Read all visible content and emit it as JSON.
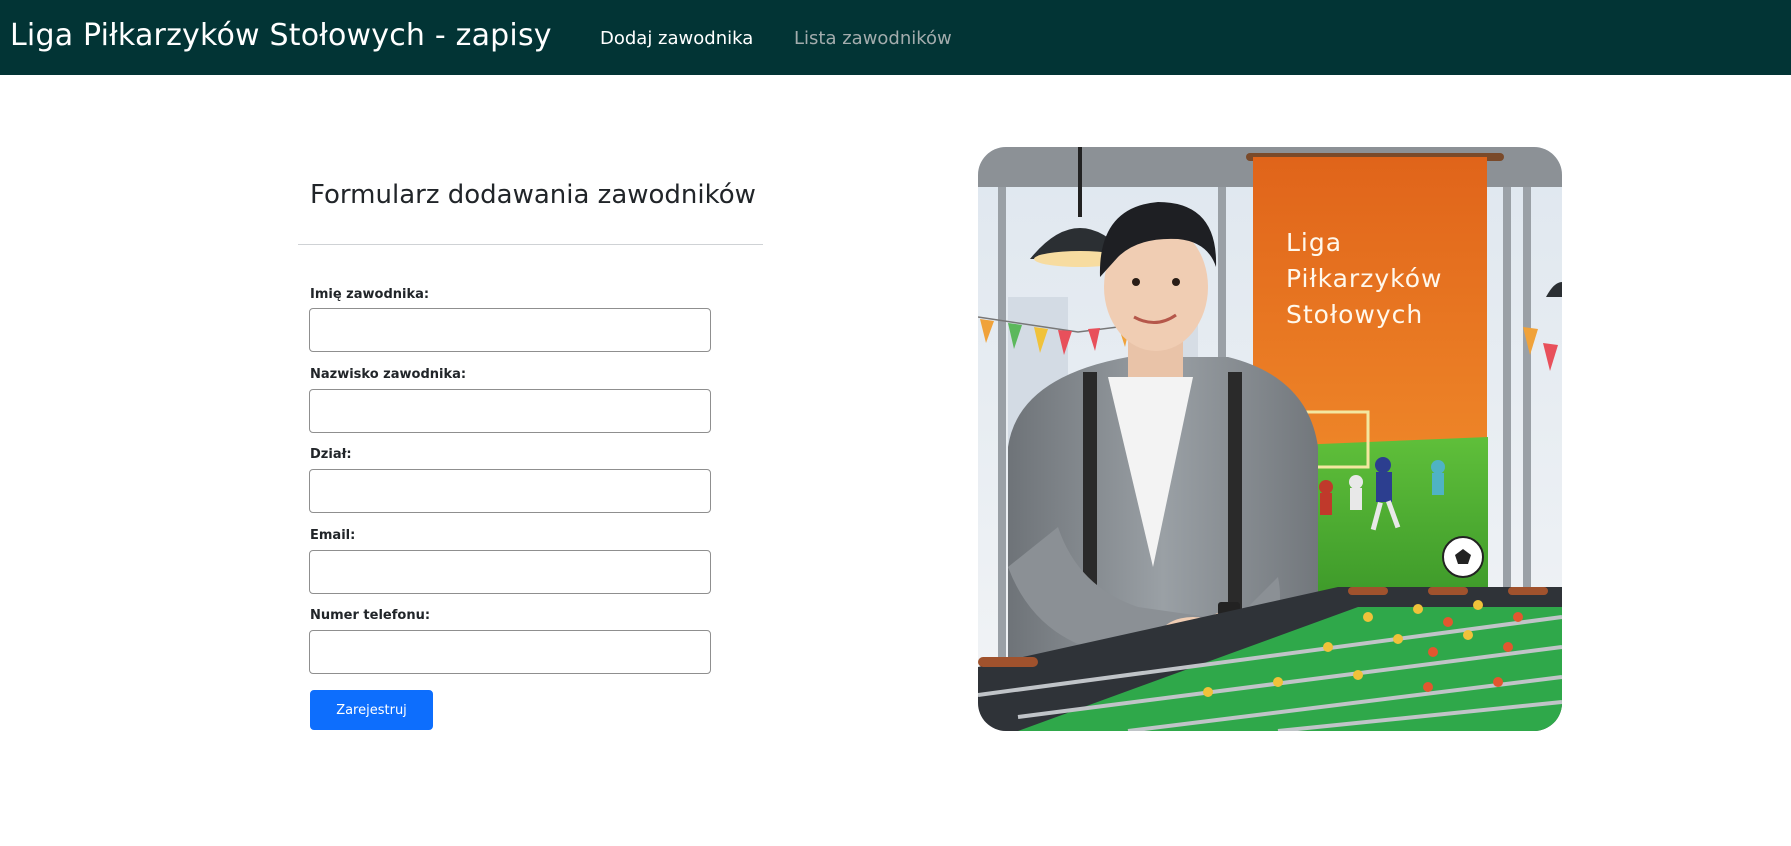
{
  "navbar": {
    "brand": "Liga Piłkarzyków Stołowych - zapisy",
    "links": [
      {
        "label": "Dodaj zawodnika",
        "active": true
      },
      {
        "label": "Lista zawodników",
        "active": false
      }
    ]
  },
  "form": {
    "title": "Formularz dodawania zawodników",
    "fields": [
      {
        "label": "Imię zawodnika:",
        "value": "",
        "placeholder": ""
      },
      {
        "label": "Nazwisko zawodnika:",
        "value": "",
        "placeholder": ""
      },
      {
        "label": "Dział:",
        "value": "",
        "placeholder": ""
      },
      {
        "label": "Email:",
        "value": "",
        "placeholder": ""
      },
      {
        "label": "Numer telefonu:",
        "value": "",
        "placeholder": ""
      }
    ],
    "submit_label": "Zarejestruj"
  },
  "hero": {
    "banner_lines": [
      "Liga",
      "Piłkarzyków",
      "Stołowych"
    ]
  },
  "colors": {
    "navbar_bg": "#023435",
    "primary": "#0d6efd",
    "banner_orange": "#e8761e"
  }
}
